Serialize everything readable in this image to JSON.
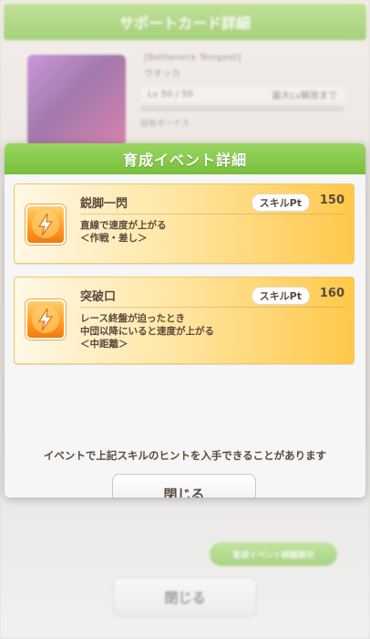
{
  "background": {
    "header_title": "サポートカード詳細",
    "card_name": "[Bottleneck Tempest]",
    "card_owner": "ウオッカ",
    "level_text": "Lv 50 / 50",
    "level_extra": "最大Lv解放まで",
    "effect_label": "固有ボーナス",
    "green_button_label": "育成イベント詳細表示",
    "close_label": "閉じる"
  },
  "modal": {
    "title": "育成イベント詳細",
    "skills": [
      {
        "name": "鋭脚一閃",
        "pt_label": "スキルPt",
        "pt_value": "150",
        "desc": [
          "直線で速度が上がる",
          "＜作戦・差し＞"
        ],
        "icon": "speed-up-icon"
      },
      {
        "name": "突破口",
        "pt_label": "スキルPt",
        "pt_value": "160",
        "desc": [
          "レース終盤が迫ったとき",
          "中団以降にいると速度が上がる",
          "＜中距離＞"
        ],
        "icon": "speed-up-icon"
      }
    ],
    "hint": "イベントで上記スキルのヒントを入手できることがあります",
    "close_label": "閉じる"
  },
  "colors": {
    "header_green": "#76bf3a",
    "card_gold": "#ffc84a",
    "text_brown": "#5b4a3e"
  }
}
